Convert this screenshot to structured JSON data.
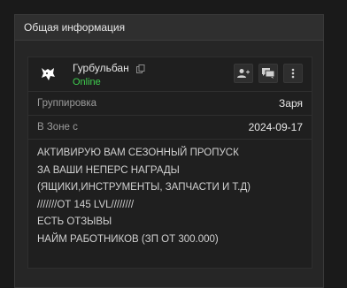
{
  "panel": {
    "title": "Общая информация"
  },
  "profile": {
    "name": "Гурбульбан",
    "status": "Online",
    "avatar_icon": "wolf-icon",
    "status_color": "#3fcf4f"
  },
  "actions": [
    {
      "icon": "add-friend-icon"
    },
    {
      "icon": "chat-icon"
    },
    {
      "icon": "more-vertical-icon"
    }
  ],
  "fields": {
    "group": {
      "label": "Группировка",
      "value": "Заря"
    },
    "zone": {
      "label": "В Зоне с",
      "value": "2024-09-17"
    }
  },
  "description": {
    "lines": [
      "АКТИВИРУЮ ВАМ СЕЗОННЫЙ ПРОПУСК",
      "ЗА ВАШИ НЕПЕРС НАГРАДЫ",
      "(ЯЩИКИ,ИНСТРУМЕНТЫ, ЗАПЧАСТИ И Т.Д)",
      "///////ОТ 145 LVL////////",
      "ЕСТЬ ОТЗЫВЫ",
      "НАЙМ РАБОТНИКОВ (ЗП ОТ 300.000)"
    ]
  }
}
